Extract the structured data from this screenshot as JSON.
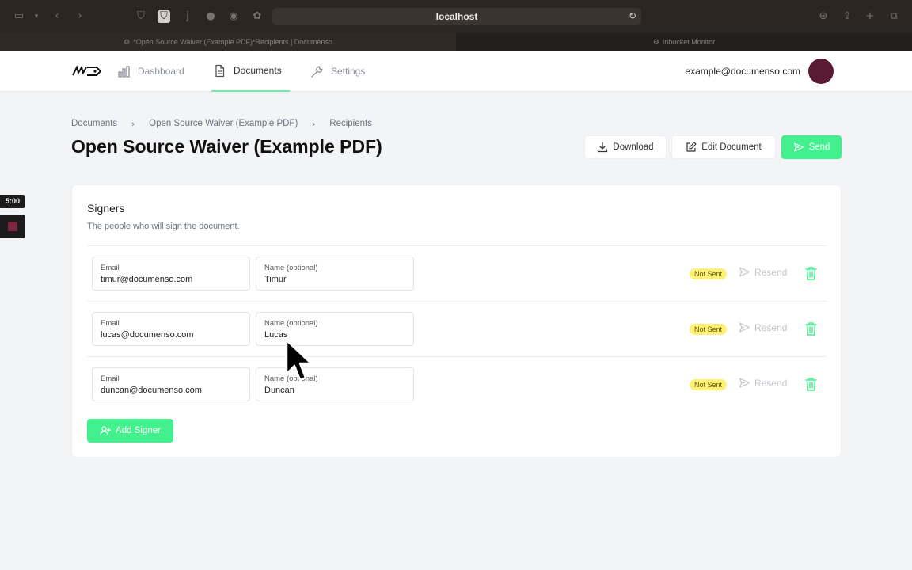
{
  "browser": {
    "url": "localhost",
    "tabs": [
      {
        "title": "*Open Source Waiver (Example PDF)*Recipients | Documenso",
        "active": true
      },
      {
        "title": "Inbucket Monitor",
        "active": false
      }
    ]
  },
  "nav": {
    "items": [
      {
        "label": "Dashboard",
        "icon": "bar-chart-icon"
      },
      {
        "label": "Documents",
        "icon": "document-icon"
      },
      {
        "label": "Settings",
        "icon": "wrench-icon"
      }
    ],
    "user_email": "example@documenso.com"
  },
  "recording": {
    "time": "5:00"
  },
  "breadcrumb": [
    "Documents",
    "Open Source Waiver (Example PDF)",
    "Recipients"
  ],
  "page": {
    "title": "Open Source Waiver (Example PDF)"
  },
  "actions": {
    "download": "Download",
    "edit": "Edit Document",
    "send": "Send"
  },
  "signers": {
    "title": "Signers",
    "description": "The people who will sign the document.",
    "email_label": "Email",
    "name_label": "Name (optional)",
    "resend_label": "Resend",
    "rows": [
      {
        "email": "timur@documenso.com",
        "name": "Timur",
        "status": "Not Sent"
      },
      {
        "email": "lucas@documenso.com",
        "name": "Lucas",
        "status": "Not Sent"
      },
      {
        "email": "duncan@documenso.com",
        "name": "Duncan",
        "status": "Not Sent"
      }
    ],
    "add_label": "Add Signer"
  },
  "colors": {
    "accent": "#43f08e",
    "badge": "#fff178",
    "avatar": "#5a1a33"
  }
}
